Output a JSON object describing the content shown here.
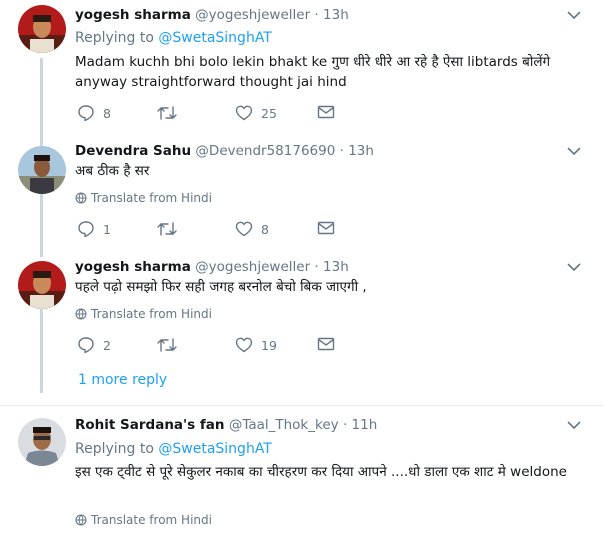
{
  "tweets": [
    {
      "name": "yogesh sharma",
      "handle": "@yogeshjeweller",
      "sep": "·",
      "time": "13h",
      "replying_label": "Replying to",
      "replying_to": "@SwetaSinghAT",
      "text": "Madam kuchh bhi bolo lekin bhakt ke  गुण धीरे धीरे आ रहे है ऐसा libtards बोलेंगे anyway straightforward thought jai hind",
      "replies": "8",
      "retweets": "",
      "likes": "25"
    },
    {
      "name": "Devendra Sahu",
      "handle": "@Devendr58176690",
      "sep": "·",
      "time": "13h",
      "text": "अब ठीक है सर",
      "translate": "Translate from Hindi",
      "replies": "1",
      "retweets": "",
      "likes": "8"
    },
    {
      "name": "yogesh sharma",
      "handle": "@yogeshjeweller",
      "sep": "·",
      "time": "13h",
      "text": "पहले पढ़ो समझो फिर सही जगह बरनोल बेचो बिक जाएगी ,",
      "translate": "Translate from Hindi",
      "replies": "2",
      "retweets": "",
      "likes": "19"
    },
    {
      "name": "Rohit Sardana's fan",
      "handle": "@Taal_Thok_key",
      "sep": "·",
      "time": "11h",
      "replying_label": "Replying to",
      "replying_to": "@SwetaSinghAT",
      "text": "इस एक ट्वीट से पूरे सेकुलर नकाब का चीरहरण कर दिया आपने ....धो डाला एक शाट मे weldone",
      "translate": "Translate from Hindi"
    }
  ],
  "more_replies": "1 more reply",
  "colors": {
    "accent": "#1da1f2",
    "muted": "#657786",
    "thread": "#ccd6dd"
  }
}
